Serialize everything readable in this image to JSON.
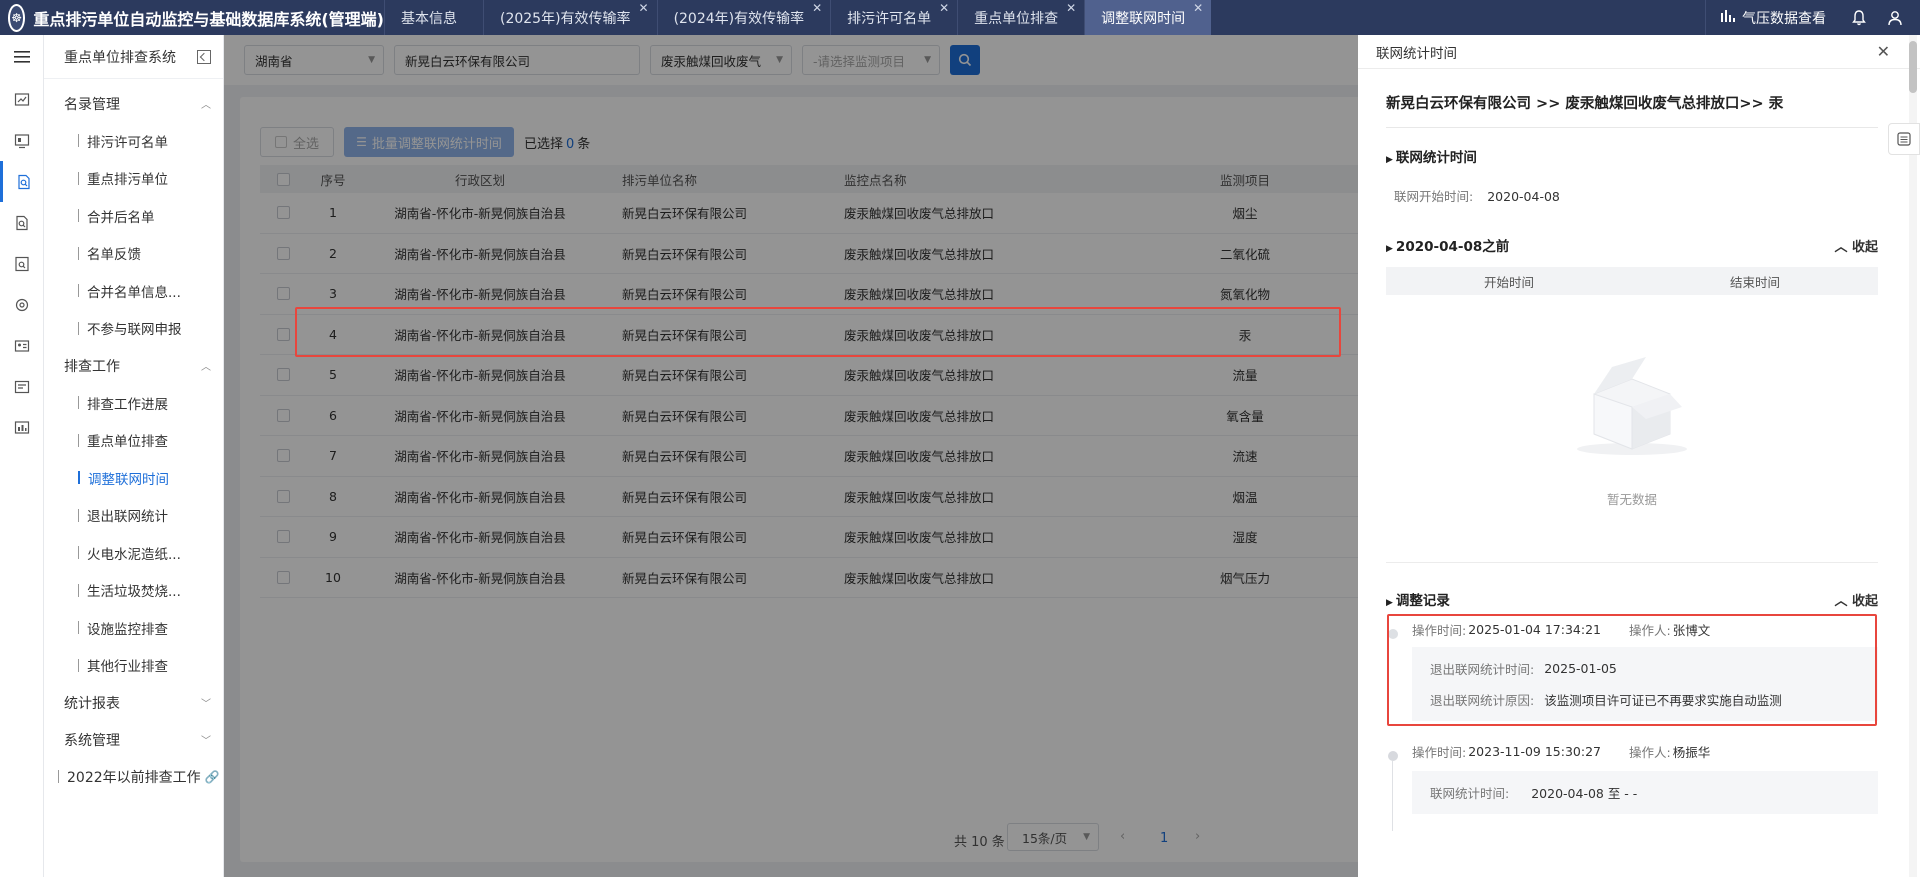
{
  "app": {
    "title": "重点排污单位自动监控与基础数据库系统(管理端)",
    "logo_glyph": "☸",
    "tabs": [
      {
        "label": "基本信息",
        "closable": false,
        "active": false
      },
      {
        "label": "(2025年)有效传输率",
        "closable": true,
        "active": false
      },
      {
        "label": "(2024年)有效传输率",
        "closable": true,
        "active": false
      },
      {
        "label": "排污许可名单",
        "closable": true,
        "active": false
      },
      {
        "label": "重点单位排查",
        "closable": true,
        "active": false
      },
      {
        "label": "调整联网时间",
        "closable": true,
        "active": true
      }
    ],
    "weather_link": "气压数据查看",
    "accent": "#1e6fd9",
    "topbar_color": "#2c3a5e"
  },
  "sidebar": {
    "system_title": "重点单位排查系统",
    "groups": [
      {
        "label": "名录管理",
        "expanded": true,
        "items": [
          "排污许可名单",
          "重点排污单位",
          "合并后名单",
          "名单反馈",
          "合并名单信息...",
          "不参与联网申报"
        ]
      },
      {
        "label": "排查工作",
        "expanded": true,
        "items": [
          "排查工作进展",
          "重点单位排查",
          "调整联网时间",
          "退出联网统计",
          "火电水泥造纸...",
          "生活垃圾焚烧...",
          "设施监控排查",
          "其他行业排查"
        ]
      },
      {
        "label": "统计报表",
        "expanded": false,
        "items": []
      },
      {
        "label": "系统管理",
        "expanded": false,
        "items": []
      }
    ],
    "active_item": "调整联网时间",
    "extra_link": "2022年以前排查工作"
  },
  "filters": {
    "province": "湖南省",
    "company": "新晃白云环保有限公司",
    "outlet": "废汞触煤回收废气",
    "item_placeholder": "-请选择监测项目"
  },
  "toolbar": {
    "select_all": "全选",
    "batch_adjust": "批量调整联网统计时间",
    "selected_prefix": "已选择",
    "selected_count": "0",
    "selected_suffix": "条"
  },
  "table": {
    "headers": [
      "序号",
      "行政区划",
      "排污单位名称",
      "监控点名称",
      "监测项目"
    ],
    "rows": [
      [
        "1",
        "湖南省-怀化市-新晃侗族自治县",
        "新晃白云环保有限公司",
        "废汞触煤回收废气总排放口",
        "烟尘"
      ],
      [
        "2",
        "湖南省-怀化市-新晃侗族自治县",
        "新晃白云环保有限公司",
        "废汞触煤回收废气总排放口",
        "二氧化硫"
      ],
      [
        "3",
        "湖南省-怀化市-新晃侗族自治县",
        "新晃白云环保有限公司",
        "废汞触煤回收废气总排放口",
        "氮氧化物"
      ],
      [
        "4",
        "湖南省-怀化市-新晃侗族自治县",
        "新晃白云环保有限公司",
        "废汞触煤回收废气总排放口",
        "汞"
      ],
      [
        "5",
        "湖南省-怀化市-新晃侗族自治县",
        "新晃白云环保有限公司",
        "废汞触煤回收废气总排放口",
        "流量"
      ],
      [
        "6",
        "湖南省-怀化市-新晃侗族自治县",
        "新晃白云环保有限公司",
        "废汞触煤回收废气总排放口",
        "氧含量"
      ],
      [
        "7",
        "湖南省-怀化市-新晃侗族自治县",
        "新晃白云环保有限公司",
        "废汞触煤回收废气总排放口",
        "流速"
      ],
      [
        "8",
        "湖南省-怀化市-新晃侗族自治县",
        "新晃白云环保有限公司",
        "废汞触煤回收废气总排放口",
        "烟温"
      ],
      [
        "9",
        "湖南省-怀化市-新晃侗族自治县",
        "新晃白云环保有限公司",
        "废汞触煤回收废气总排放口",
        "湿度"
      ],
      [
        "10",
        "湖南省-怀化市-新晃侗族自治县",
        "新晃白云环保有限公司",
        "废汞触煤回收废气总排放口",
        "烟气压力"
      ]
    ],
    "highlighted_row": 4
  },
  "pagination": {
    "total": "共 10 条",
    "page_size": "15条/页",
    "current_page": "1"
  },
  "drawer": {
    "title": "联网统计时间",
    "path": "新晃白云环保有限公司 >> 废汞触煤回收废气总排放口>> 汞",
    "section_net": "联网统计时间",
    "start_label": "联网开始时间:",
    "start_value": "2020-04-08",
    "section_before": "2020-04-08之前",
    "collapse": "收起",
    "col_start": "开始时间",
    "col_end": "结束时间",
    "empty_text": "暂无数据",
    "section_records": "调整记录",
    "records": [
      {
        "op_time_label": "操作时间:",
        "op_time": "2025-01-04 17:34:21",
        "operator_label": "操作人:",
        "operator": "张博文",
        "lines": [
          {
            "k": "退出联网统计时间:",
            "v": "2025-01-05"
          },
          {
            "k": "退出联网统计原因:",
            "v": "该监测项目许可证已不再要求实施自动监测"
          }
        ]
      },
      {
        "op_time_label": "操作时间:",
        "op_time": "2023-11-09 15:30:27",
        "operator_label": "操作人:",
        "operator": "杨振华",
        "lines": [
          {
            "k": "联网统计时间:",
            "v": "2020-04-08 至 - -"
          }
        ]
      }
    ]
  }
}
